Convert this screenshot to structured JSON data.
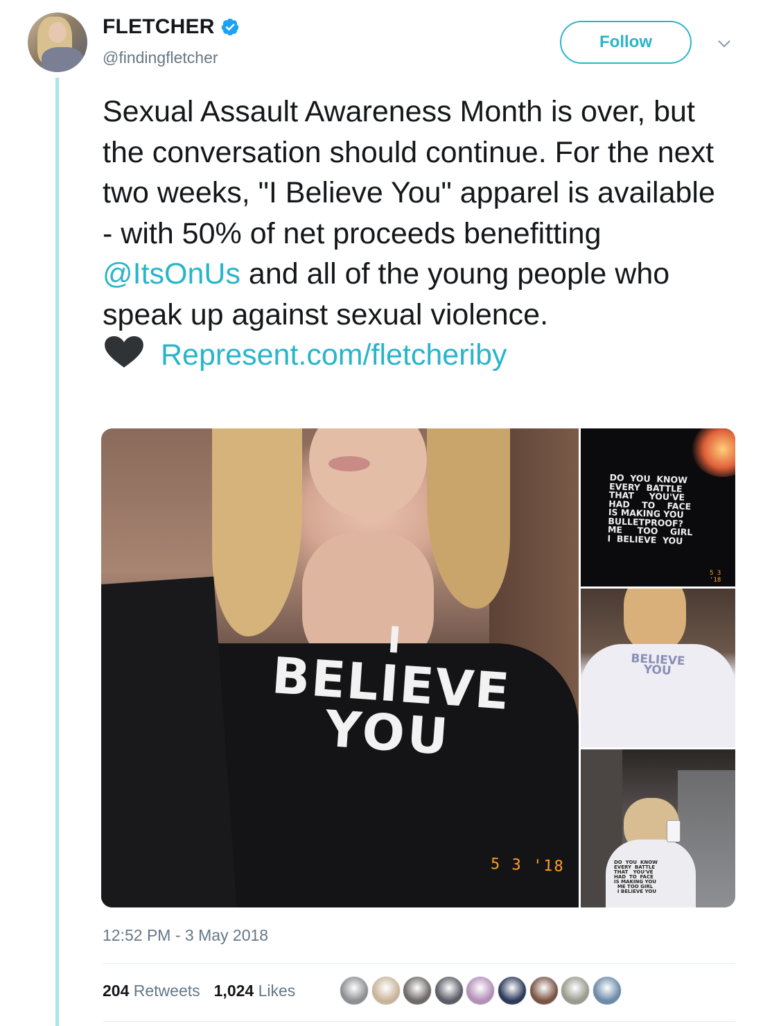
{
  "author": {
    "display_name": "FLETCHER",
    "handle": "@findingfletcher",
    "verified_icon": "verified-badge-icon",
    "avatar_icon": "avatar-image"
  },
  "actions": {
    "follow_label": "Follow",
    "more_icon": "chevron-down-icon"
  },
  "tweet": {
    "text_before_mention": "Sexual Assault Awareness Month is over, but the conversation should continue. For the next two weeks, \"I Believe You\" apparel is available - with 50% of net proceeds benefitting ",
    "mention": "@ItsOnUs",
    "text_after_mention": " and all of the young people who speak up against sexual violence.",
    "emoji_icon": "black-heart-icon",
    "link": "Represent.com/fletcheriby"
  },
  "media": {
    "main": {
      "shirt_line1": "I",
      "shirt_line2": "BELIEVE",
      "shirt_line3": "YOU",
      "date_stamp": "5 3 '18"
    },
    "side1": {
      "shirt_text": "DO  YOU  KNOW\nEVERY  BATTLE\nTHAT     YOU'VE\nHAD    TO    FACE\nIS MAKING YOU\nBULLETPROOF?\nME     TOO    GIRL\nI  BELIEVE  YOU",
      "date_stamp": "5 3 '18"
    },
    "side2": {
      "shirt_line1": "BELIEVE",
      "shirt_line2": "YOU"
    },
    "side3": {
      "shirt_text": "DO  YOU  KNOW\nEVERY  BATTLE\nTHAT   YOU'VE\nHAD  TO  FACE\nIS MAKING YOU\n  ME TOO GIRL\n  I BELIEVE YOU"
    }
  },
  "timestamp": "12:52 PM - 3 May 2018",
  "stats": {
    "retweets_count": "204",
    "retweets_label": "Retweets",
    "likes_count": "1,024",
    "likes_label": "Likes"
  },
  "likers": [
    {
      "color": "#8d8f92"
    },
    {
      "color": "#c9b49a"
    },
    {
      "color": "#6f6a68"
    },
    {
      "color": "#5b5d66"
    },
    {
      "color": "#b48fb8"
    },
    {
      "color": "#2d3a5a"
    },
    {
      "color": "#7a5545"
    },
    {
      "color": "#9a9a8e"
    },
    {
      "color": "#6d8aa8"
    }
  ],
  "colors": {
    "accent": "#29b5c9",
    "thread_line": "#a6e6ec",
    "text": "#14171a",
    "muted": "#657786",
    "verified": "#1da1f2"
  }
}
